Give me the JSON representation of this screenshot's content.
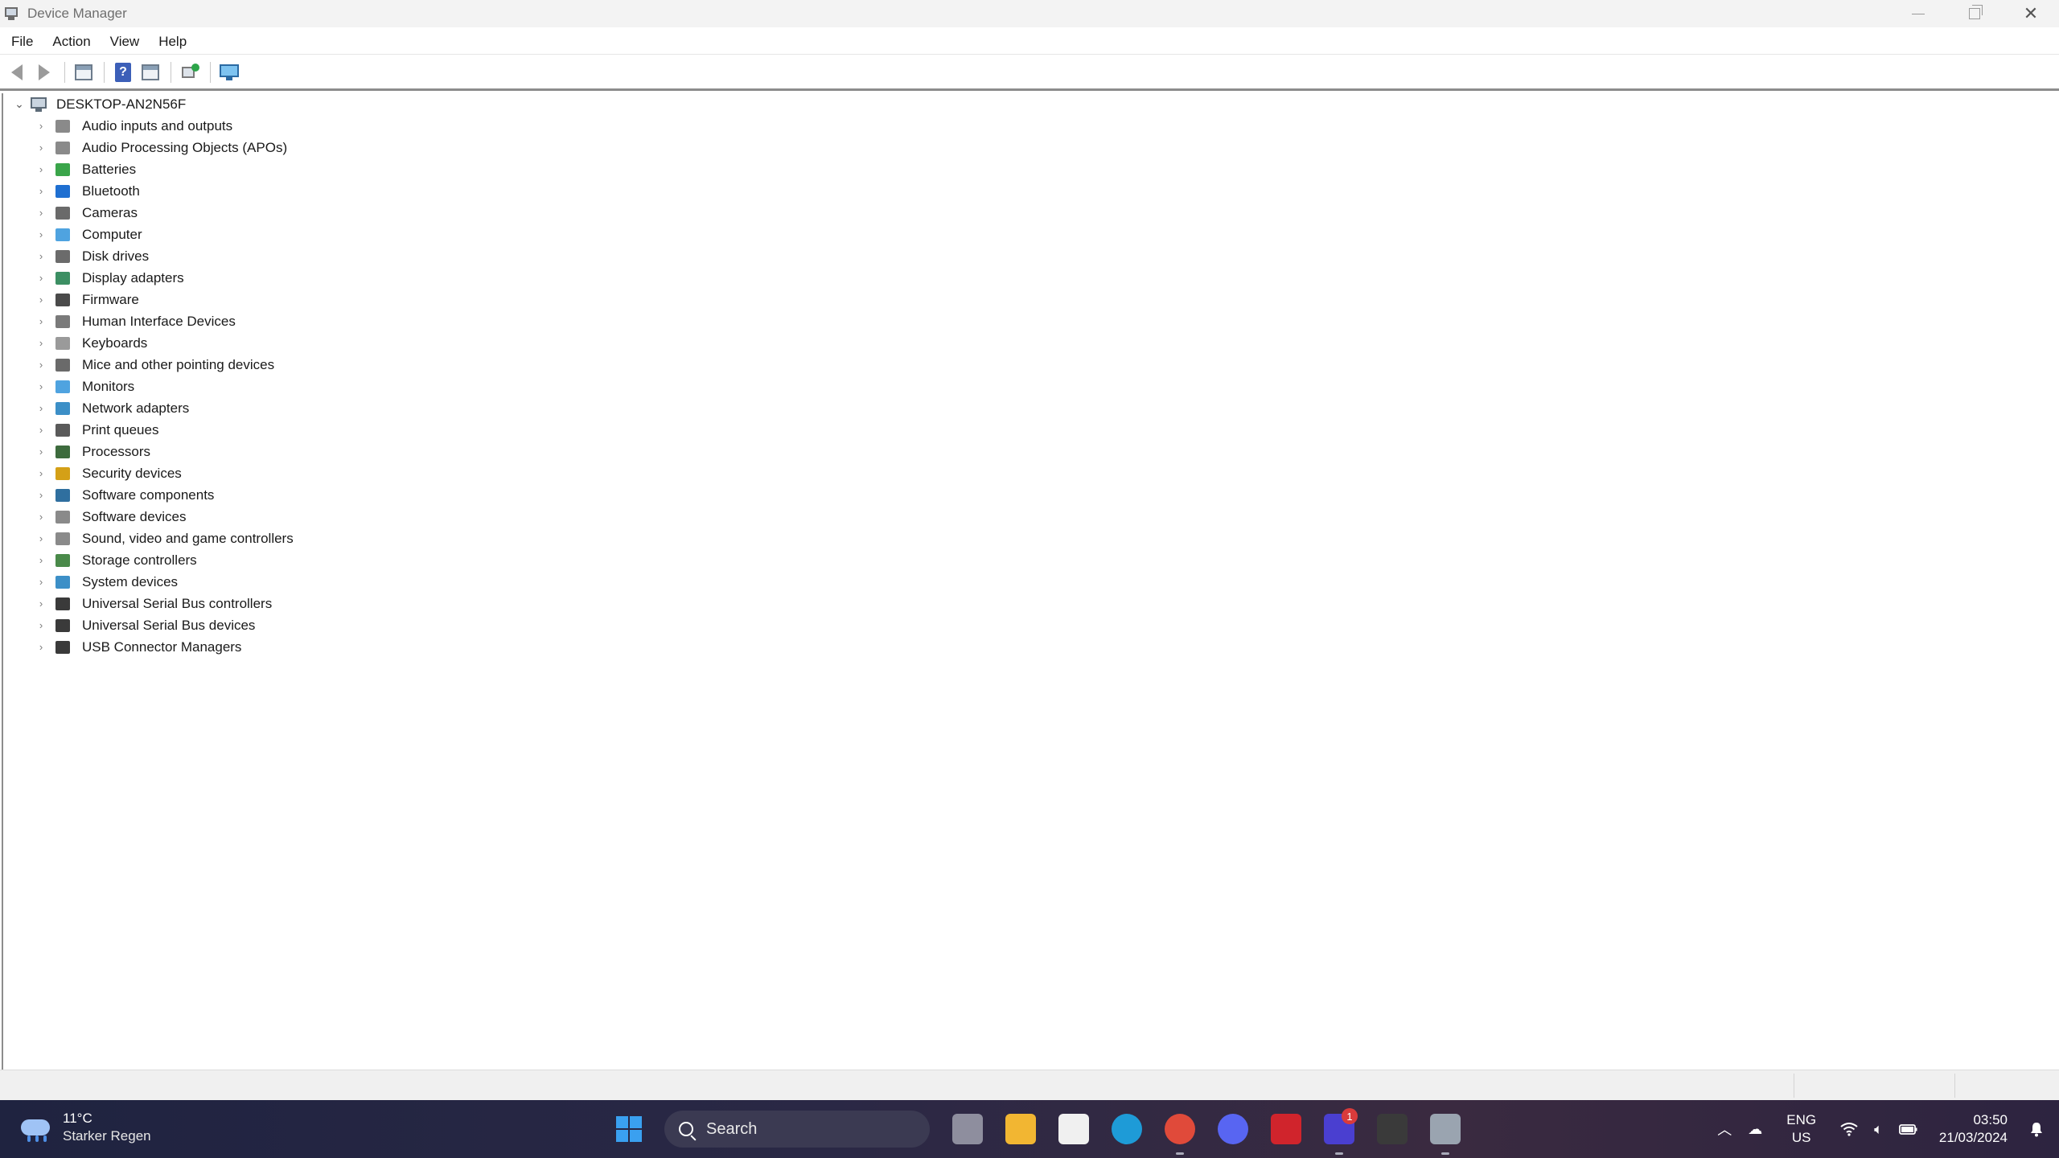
{
  "window": {
    "title": "Device Manager",
    "controls": {
      "minimize": "minimize",
      "maximize": "restore",
      "close": "✕"
    }
  },
  "menu": {
    "items": [
      "File",
      "Action",
      "View",
      "Help"
    ]
  },
  "toolbar": {
    "buttons": [
      "back-arrow-icon",
      "forward-arrow-icon",
      "properties-sheet-icon",
      "help-icon",
      "show-hide-tree-icon",
      "scan-hardware-icon",
      "add-legacy-hardware-icon"
    ]
  },
  "tree": {
    "root": "DESKTOP-AN2N56F",
    "categories": [
      {
        "label": "Audio inputs and outputs",
        "icon": "speaker-icon",
        "color": "#8a8a8a"
      },
      {
        "label": "Audio Processing Objects (APOs)",
        "icon": "speaker-icon",
        "color": "#8a8a8a"
      },
      {
        "label": "Batteries",
        "icon": "battery-icon",
        "color": "#3aa54a"
      },
      {
        "label": "Bluetooth",
        "icon": "bluetooth-icon",
        "color": "#1f6fd1"
      },
      {
        "label": "Cameras",
        "icon": "camera-icon",
        "color": "#6a6a6a"
      },
      {
        "label": "Computer",
        "icon": "computer-icon",
        "color": "#4fa3e0"
      },
      {
        "label": "Disk drives",
        "icon": "disk-drive-icon",
        "color": "#6b6b6b"
      },
      {
        "label": "Display adapters",
        "icon": "display-adapter-icon",
        "color": "#3c8f63"
      },
      {
        "label": "Firmware",
        "icon": "firmware-icon",
        "color": "#4a4a4a"
      },
      {
        "label": "Human Interface Devices",
        "icon": "hid-icon",
        "color": "#7a7a7a"
      },
      {
        "label": "Keyboards",
        "icon": "keyboard-icon",
        "color": "#9a9a9a"
      },
      {
        "label": "Mice and other pointing devices",
        "icon": "mouse-icon",
        "color": "#6a6a6a"
      },
      {
        "label": "Monitors",
        "icon": "monitor-icon",
        "color": "#4fa3e0"
      },
      {
        "label": "Network adapters",
        "icon": "network-adapter-icon",
        "color": "#3c8fc7"
      },
      {
        "label": "Print queues",
        "icon": "printer-icon",
        "color": "#5a5a5a"
      },
      {
        "label": "Processors",
        "icon": "processor-icon",
        "color": "#3d6b3d"
      },
      {
        "label": "Security devices",
        "icon": "security-device-icon",
        "color": "#d4a017"
      },
      {
        "label": "Software components",
        "icon": "software-component-icon",
        "color": "#2f6f9f"
      },
      {
        "label": "Software devices",
        "icon": "software-device-icon",
        "color": "#8a8a8a"
      },
      {
        "label": "Sound, video and game controllers",
        "icon": "speaker-icon",
        "color": "#8a8a8a"
      },
      {
        "label": "Storage controllers",
        "icon": "storage-controller-icon",
        "color": "#4a8a4a"
      },
      {
        "label": "System devices",
        "icon": "system-device-icon",
        "color": "#3c8fc7"
      },
      {
        "label": "Universal Serial Bus controllers",
        "icon": "usb-icon",
        "color": "#3a3a3a"
      },
      {
        "label": "Universal Serial Bus devices",
        "icon": "usb-icon",
        "color": "#3a3a3a"
      },
      {
        "label": "USB Connector Managers",
        "icon": "usb-icon",
        "color": "#3a3a3a"
      }
    ]
  },
  "taskbar": {
    "weather": {
      "temp": "11°C",
      "desc": "Starker Regen"
    },
    "search_label": "Search",
    "apps": [
      {
        "name": "task-view",
        "color": "#8e8e9e",
        "glyph": ""
      },
      {
        "name": "file-explorer",
        "color": "#f2b632",
        "glyph": ""
      },
      {
        "name": "microsoft-store",
        "color": "#f0f0f0",
        "glyph": ""
      },
      {
        "name": "edge",
        "color": "#1e9bd7",
        "glyph": ""
      },
      {
        "name": "chrome",
        "color": "#e04a3a",
        "glyph": ""
      },
      {
        "name": "discord",
        "color": "#5865f2",
        "glyph": ""
      },
      {
        "name": "amd-software",
        "color": "#d0242c",
        "glyph": ""
      },
      {
        "name": "design-app",
        "color": "#4a3fd0",
        "glyph": ""
      },
      {
        "name": "unity",
        "color": "#3a3a3a",
        "glyph": ""
      },
      {
        "name": "device-manager",
        "color": "#9aa4b0",
        "glyph": ""
      }
    ],
    "badge": "1",
    "tray": {
      "lang_top": "ENG",
      "lang_bottom": "US",
      "time": "03:50",
      "date": "21/03/2024"
    }
  }
}
